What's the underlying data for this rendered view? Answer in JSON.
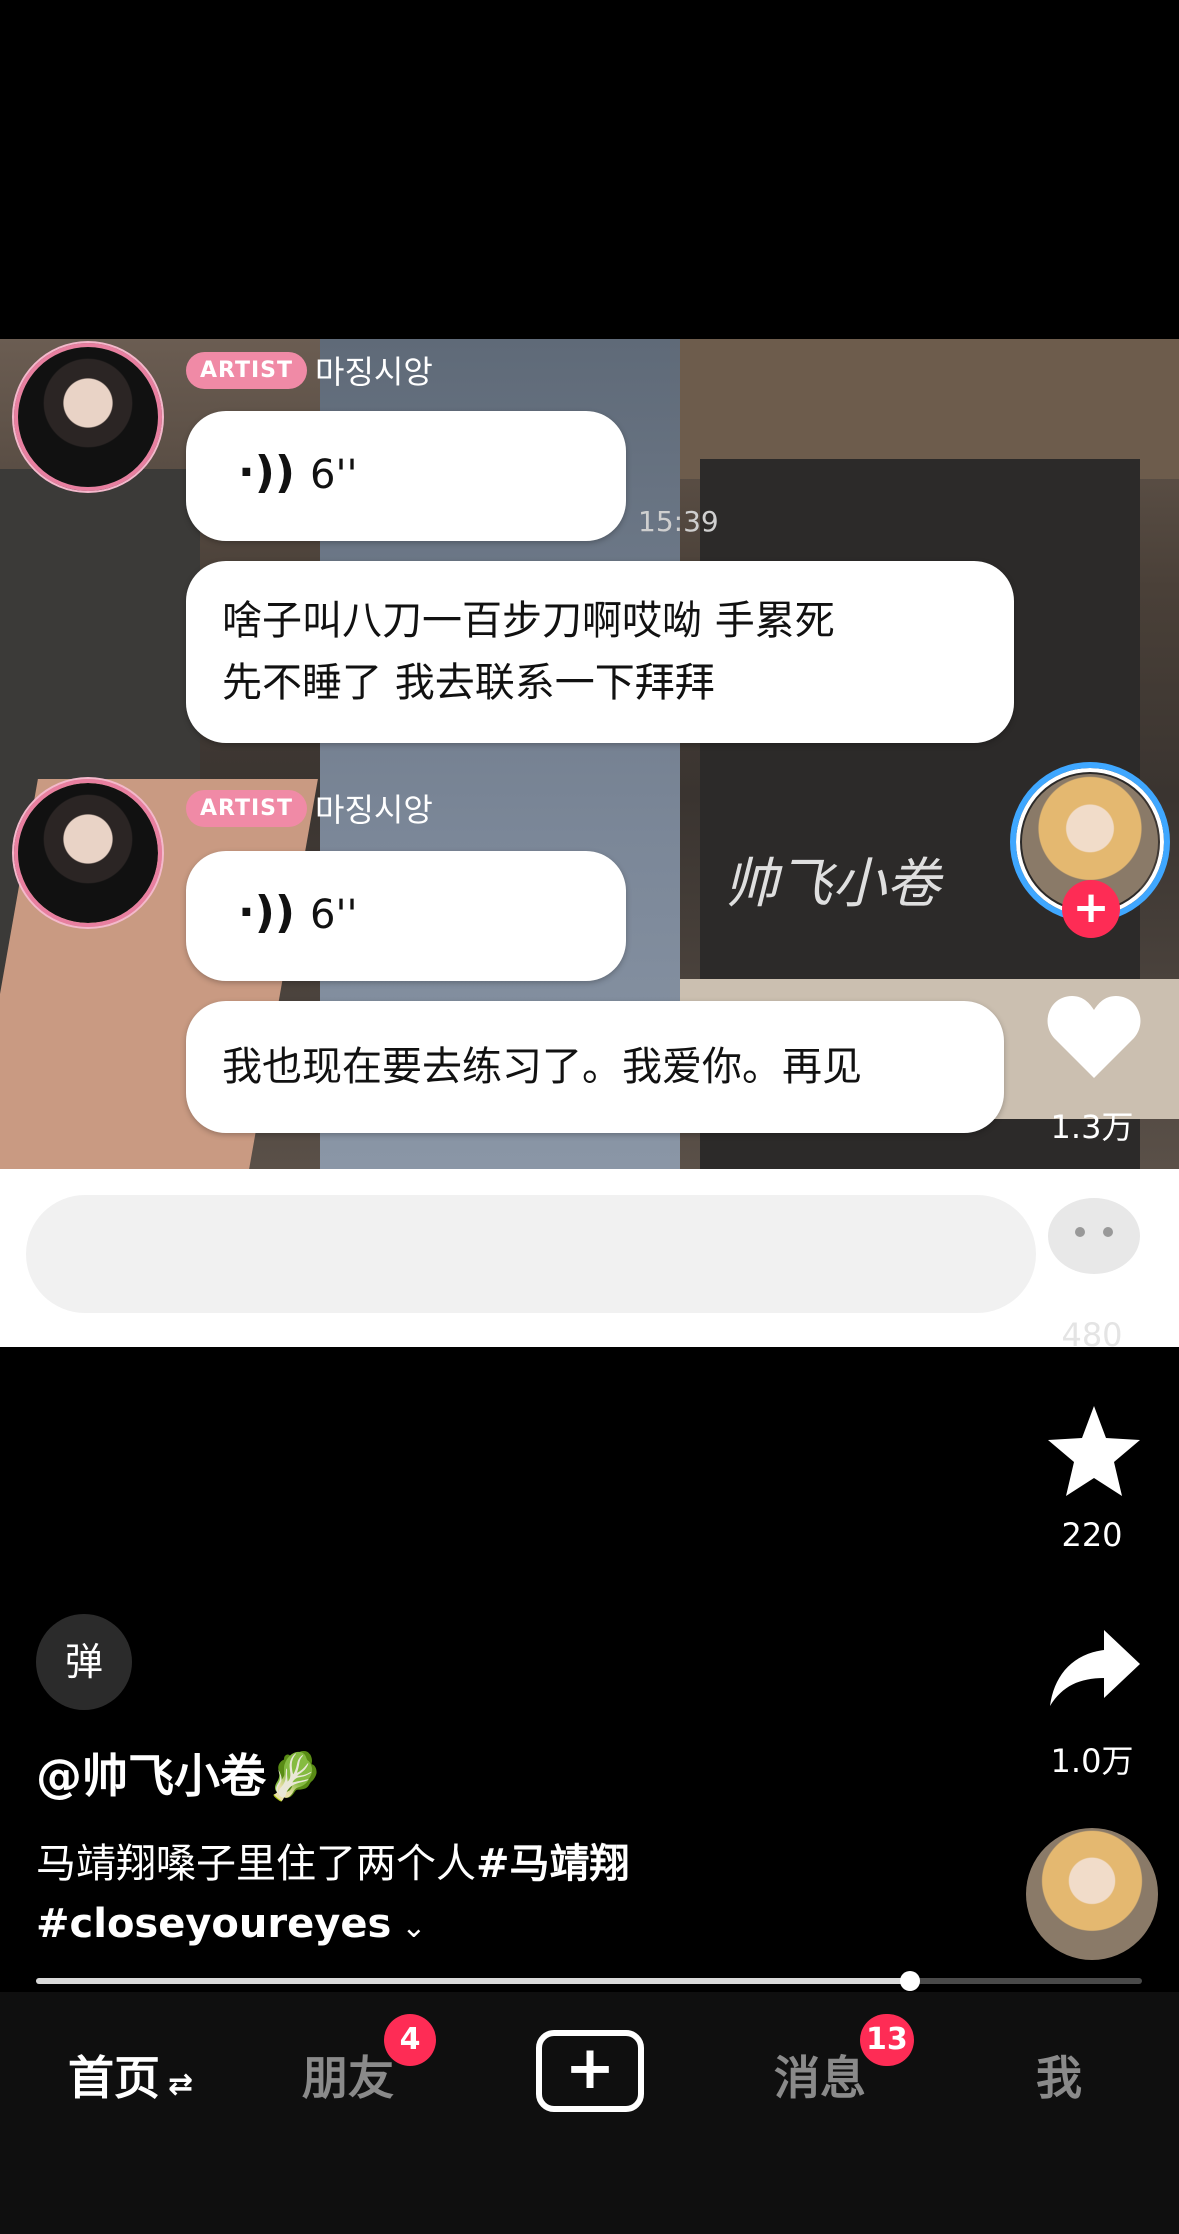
{
  "chat": {
    "badge": "ARTIST",
    "sender_name": "마징시앙",
    "messages": [
      {
        "voice_duration": "6''"
      },
      {
        "line1": "啥子叫八刀一百步刀啊哎呦 手累死",
        "line2": "先不睡了 我去联系一下拜拜"
      },
      {
        "voice_duration": "6''"
      },
      {
        "line1": "我也现在要去练习了。我爱你。再见"
      }
    ],
    "timestamp": "15:39",
    "watermark": "帅飞小卷"
  },
  "actions": {
    "like_count": "1.3万",
    "comment_count": "480",
    "favorite_count": "220",
    "share_count": "1.0万"
  },
  "video": {
    "danmu_label": "弹",
    "author": "@帅飞小卷🥬",
    "desc_line1_plain": "马靖翔嗓子里住了两个人",
    "desc_line1_tag": "#马靖翔",
    "desc_line2_tag": "#closeyoureyes",
    "progress": 0.79
  },
  "tabbar": {
    "home": "首页",
    "friends": "朋友",
    "friends_badge": "4",
    "messages": "消息",
    "messages_badge": "13",
    "me": "我"
  }
}
